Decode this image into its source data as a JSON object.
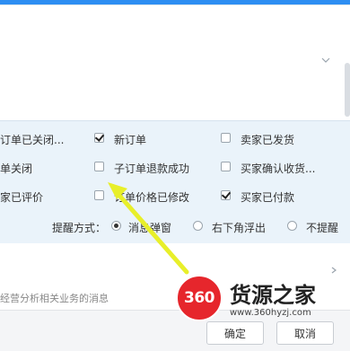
{
  "colors": {
    "accent": "#2d8ef2",
    "settings_bg": "#eaf3fa",
    "arrow": "#e8ef2a",
    "watermark_red": "#e6262c"
  },
  "notifications": {
    "row1": [
      {
        "label": "订单已关闭...",
        "checked": false
      },
      {
        "label": "新订单",
        "checked": true
      },
      {
        "label": "卖家已发货",
        "checked": false
      }
    ],
    "row2": [
      {
        "label": "单关闭",
        "checked": false
      },
      {
        "label": "子订单退款成功",
        "checked": false
      },
      {
        "label": "买家确认收货...",
        "checked": false
      }
    ],
    "row3": [
      {
        "label": "家已评价",
        "checked": false
      },
      {
        "label": "订单价格已修改",
        "checked": false
      },
      {
        "label": "买家已付款",
        "checked": true
      }
    ]
  },
  "reminder": {
    "label": "提醒方式：",
    "options": [
      {
        "label": "消息弹窗",
        "selected": true
      },
      {
        "label": "右下角浮出",
        "selected": false
      },
      {
        "label": "不提醒",
        "selected": false
      }
    ]
  },
  "section": {
    "message": "经营分析相关业务的消息"
  },
  "footer": {
    "confirm_label": "确定",
    "cancel_label": "取消"
  },
  "watermark": {
    "logo": "360",
    "text": "货源之家",
    "url": "www.360hyzj.com"
  }
}
